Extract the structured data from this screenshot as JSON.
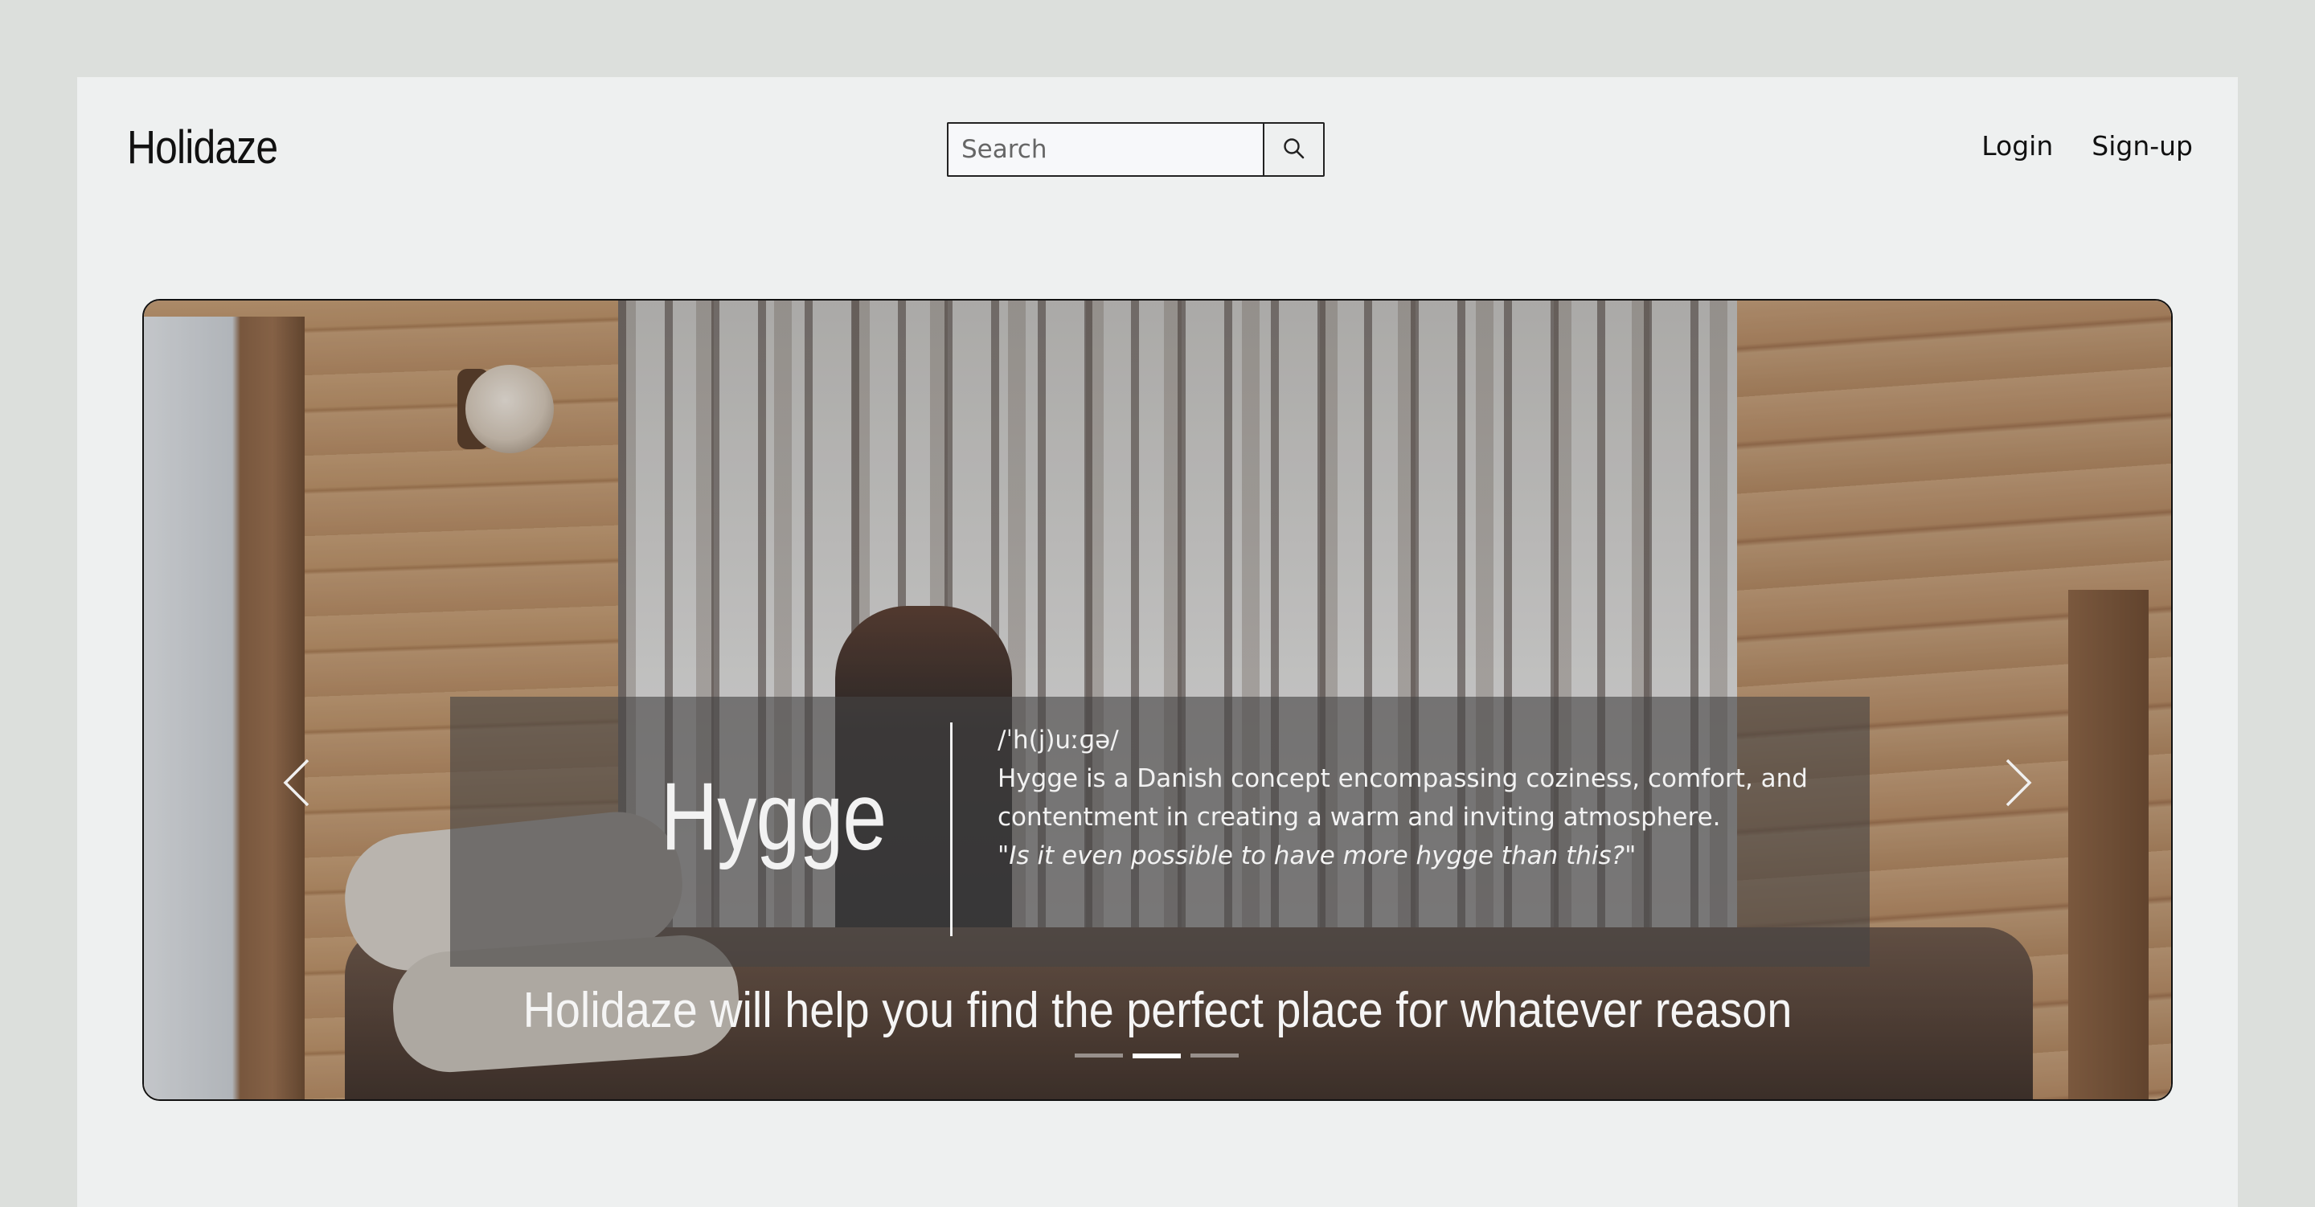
{
  "header": {
    "logo": "Holidaze",
    "search": {
      "placeholder": "Search",
      "value": ""
    },
    "nav": {
      "login": "Login",
      "signup": "Sign-up"
    }
  },
  "hero": {
    "word": "Hygge",
    "pronunciation": "/ˈh(j)uːɡə/",
    "description": "Hygge is a Danish concept encompassing coziness, comfort, and contentment in creating a warm and inviting atmosphere.",
    "quote": "\"Is it even possible to have more hygge than this?\"",
    "tagline": "Holidaze will help you find the perfect place for whatever reason",
    "slides": 3,
    "active_slide": 2
  },
  "icons": {
    "search": "search-icon",
    "prev": "chevron-left-icon",
    "next": "chevron-right-icon"
  },
  "colors": {
    "page_bg": "#dcdfdc",
    "content_bg": "#eef0f0",
    "text": "#111111",
    "caption_overlay": "rgba(70,68,68,0.62)"
  }
}
